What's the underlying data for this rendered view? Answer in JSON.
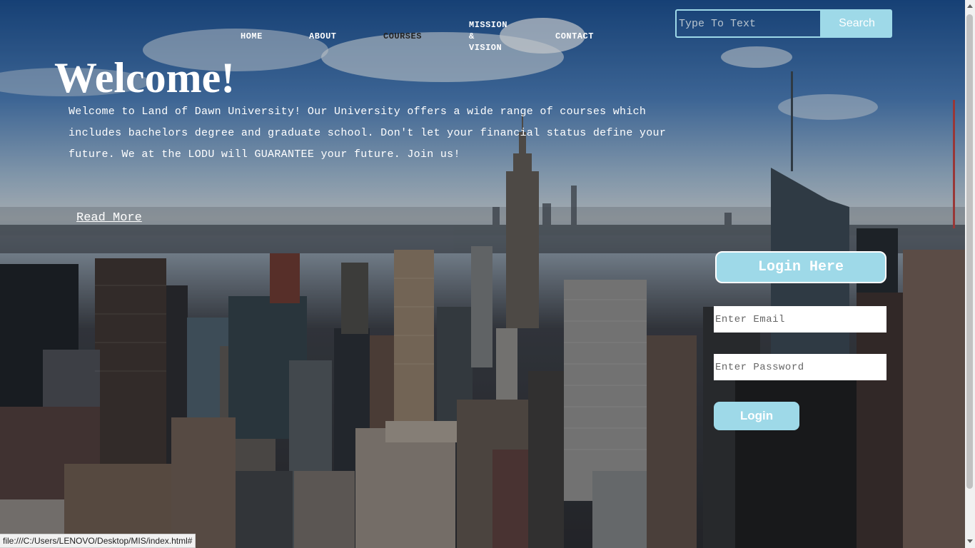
{
  "nav": {
    "home": "HOME",
    "about": "ABOUT",
    "courses": "COURSES",
    "mission_line1": "MISSION",
    "mission_line2": "&",
    "mission_line3": "VISION",
    "contact": "CONTACT"
  },
  "search": {
    "placeholder": "Type To Text",
    "button": "Search"
  },
  "hero": {
    "title": "Welcome!",
    "description": "Welcome to Land of Dawn University! Our University offers a wide range of courses which includes bachelors degree and graduate school. Don't let your financial status define your future. We at the LODU will GUARANTEE your future. Join us!",
    "read_more": "Read More"
  },
  "login": {
    "title": "Login Here",
    "email_placeholder": "Enter Email",
    "password_placeholder": "Enter Password",
    "button": "Login"
  },
  "status_bar": {
    "url": "file:///C:/Users/LENOVO/Desktop/MIS/index.html#"
  },
  "colors": {
    "accent": "#9ed9e8",
    "text": "#ffffff"
  }
}
